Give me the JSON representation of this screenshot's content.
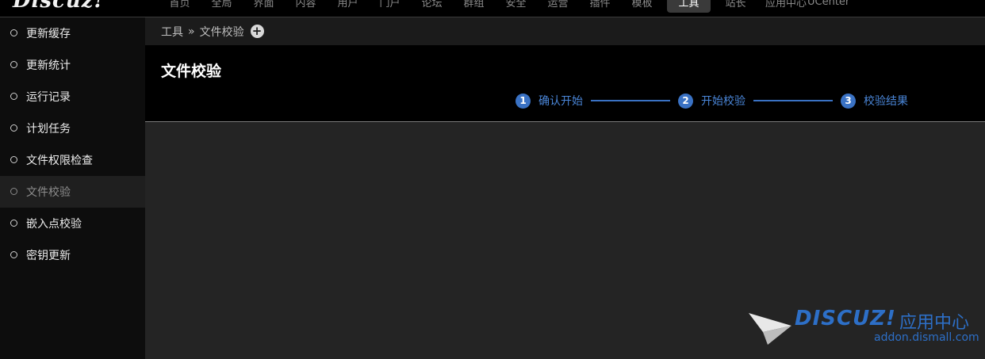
{
  "topbar": {
    "logo": "Discuz!",
    "nav": [
      "首页",
      "全局",
      "界面",
      "内容",
      "用户",
      "门户",
      "论坛",
      "群组",
      "安全",
      "运营",
      "插件",
      "模板",
      "工具",
      "站长",
      "应用中心",
      "UCenter"
    ],
    "active_index": 12
  },
  "sidebar": {
    "items": [
      {
        "label": "更新缓存"
      },
      {
        "label": "更新统计"
      },
      {
        "label": "运行记录"
      },
      {
        "label": "计划任务"
      },
      {
        "label": "文件权限检查"
      },
      {
        "label": "文件校验"
      },
      {
        "label": "嵌入点校验"
      },
      {
        "label": "密钥更新"
      }
    ],
    "active_index": 5
  },
  "breadcrumb": {
    "root": "工具",
    "separator": "»",
    "current": "文件校验",
    "add_icon": "plus-circle-icon"
  },
  "page": {
    "title": "文件校验",
    "steps": [
      {
        "num": "1",
        "label": "确认开始"
      },
      {
        "num": "2",
        "label": "开始校验"
      },
      {
        "num": "3",
        "label": "校验结果"
      }
    ]
  },
  "watermark": {
    "brand": "DISCUZ!",
    "cn": "应用中心",
    "url": "addon.dismall.com"
  },
  "colors": {
    "accent": "#3a72c4",
    "background": "#222222"
  }
}
